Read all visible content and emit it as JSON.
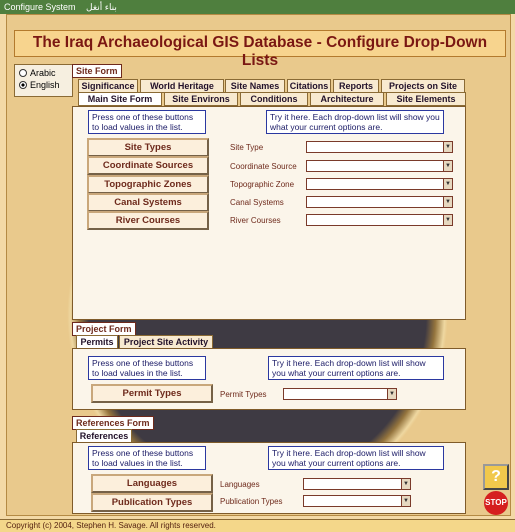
{
  "window": {
    "title": "Configure System",
    "arabic_title": "بناء أنغل"
  },
  "header": {
    "title": "The Iraq Archaeological GIS Database - Configure Drop-Down Lists"
  },
  "language": {
    "options": [
      "Arabic",
      "English"
    ],
    "selected": "English"
  },
  "site_form": {
    "label": "Site Form",
    "tabs_row1": [
      "Significance",
      "World Heritage",
      "Site Names",
      "Citations",
      "Reports",
      "Projects on Site"
    ],
    "tabs_row2": [
      "Main Site Form",
      "Site Environs",
      "Conditions",
      "Architecture",
      "Site Elements"
    ],
    "active_tab": "Main Site Form",
    "instructions_left": "Press one of these buttons to load values in the list.",
    "instructions_right": "Try it here.  Each drop-down list will show you what your current options are.",
    "buttons": [
      "Site Types",
      "Coordinate Sources",
      "Topographic Zones",
      "Canal Systems",
      "River Courses"
    ],
    "fields": [
      "Site Type",
      "Coordinate Source",
      "Topographic Zone",
      "Canal Systems",
      "River Courses"
    ]
  },
  "project_form": {
    "label": "Project Form",
    "tabs": [
      "Permits",
      "Project Site Activity"
    ],
    "active_tab": "Permits",
    "instructions_left": "Press one of these buttons to load values in the list.",
    "instructions_right": "Try it here.  Each drop-down list will show you what your current options are.",
    "buttons": [
      "Permit Types"
    ],
    "fields": [
      "Permit Types"
    ]
  },
  "references_form": {
    "label": "References Form",
    "tabs": [
      "References"
    ],
    "instructions_left": "Press one of these buttons to load values in the list.",
    "instructions_right": "Try it here.  Each drop-down list will show you what your current options are.",
    "buttons": [
      "Languages",
      "Publication Types"
    ],
    "fields": [
      "Languages",
      "Publication Types"
    ]
  },
  "help_button": {
    "label": "?"
  },
  "stop_button": {
    "label": "STOP"
  },
  "footer": {
    "text": "Copyright (c) 2004, Stephen H. Savage.  All rights reserved."
  }
}
